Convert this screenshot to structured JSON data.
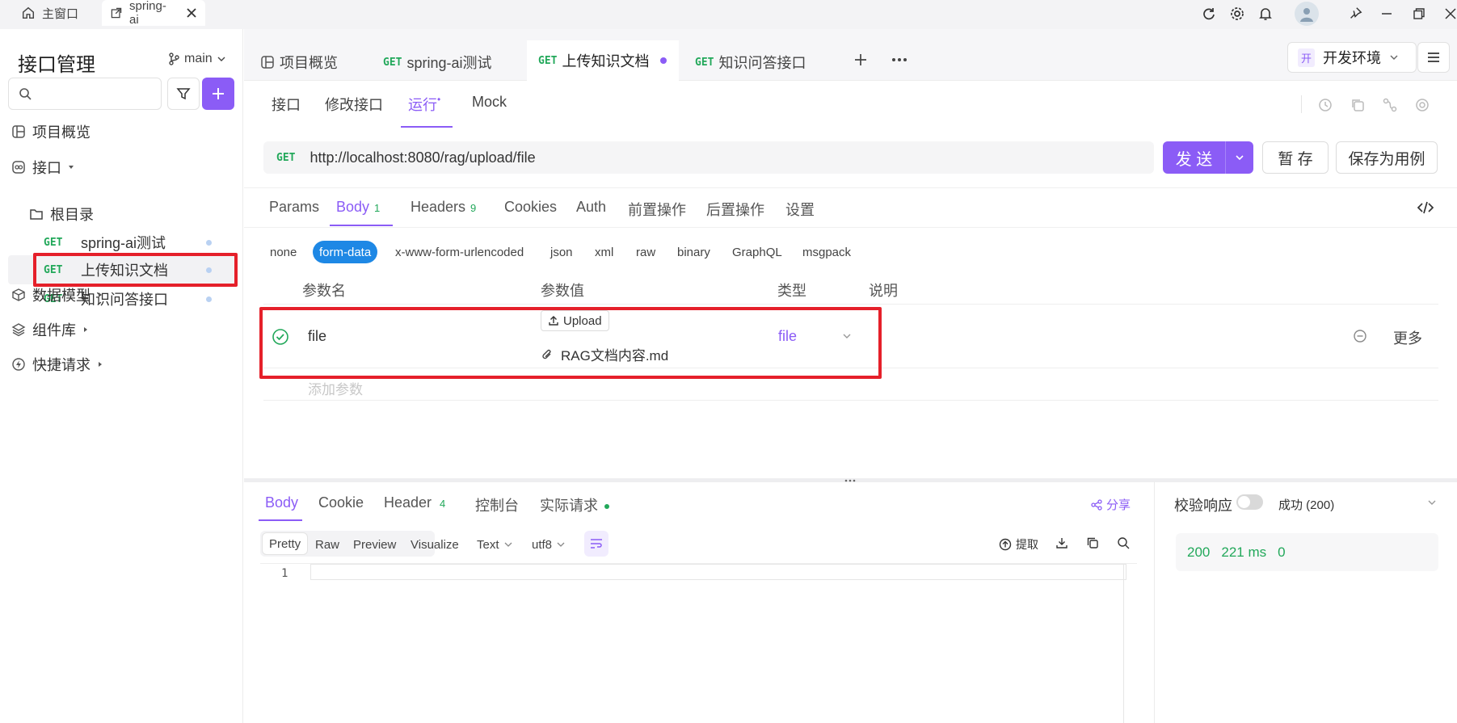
{
  "titlebar": {
    "home_tab": "主窗口",
    "project_tab": "spring-ai"
  },
  "sidebar": {
    "title": "接口管理",
    "branch": "main",
    "nav": {
      "overview": "项目概览",
      "api": "接口",
      "root": "根目录",
      "models": "数据模型",
      "components": "组件库",
      "quick": "快捷请求"
    },
    "endpoints": [
      {
        "method": "GET",
        "name": "spring-ai测试"
      },
      {
        "method": "GET",
        "name": "上传知识文档"
      },
      {
        "method": "GET",
        "name": "知识问答接口"
      }
    ]
  },
  "tabs": {
    "overview": "项目概览",
    "items": [
      {
        "method": "GET",
        "name": "spring-ai测试"
      },
      {
        "method": "GET",
        "name": "上传知识文档"
      },
      {
        "method": "GET",
        "name": "知识问答接口"
      }
    ]
  },
  "env": {
    "badge": "开",
    "label": "开发环境"
  },
  "subtabs": {
    "api": "接口",
    "edit": "修改接口",
    "run": "运行",
    "mock": "Mock"
  },
  "request": {
    "method": "GET",
    "url": "http://localhost:8080/rag/upload/file",
    "send": "发 送",
    "save_temp": "暂 存",
    "save_case": "保存为用例"
  },
  "section_tabs": {
    "params": "Params",
    "body": "Body",
    "body_count": "1",
    "headers": "Headers",
    "headers_count": "9",
    "cookies": "Cookies",
    "auth": "Auth",
    "pre": "前置操作",
    "post": "后置操作",
    "settings": "设置"
  },
  "body_types": [
    "none",
    "form-data",
    "x-www-form-urlencoded",
    "json",
    "xml",
    "raw",
    "binary",
    "GraphQL",
    "msgpack"
  ],
  "params_table": {
    "headers": {
      "name": "参数名",
      "value": "参数值",
      "type": "类型",
      "desc": "说明"
    },
    "row": {
      "name": "file",
      "upload_label": "Upload",
      "file_name": "RAG文档内容.md",
      "type": "file",
      "more": "更多"
    },
    "add_placeholder": "添加参数"
  },
  "response": {
    "tabs": {
      "body": "Body",
      "cookie": "Cookie",
      "header": "Header",
      "header_count": "4",
      "console": "控制台",
      "actual": "实际请求"
    },
    "share": "分享",
    "formats": [
      "Pretty",
      "Raw",
      "Preview",
      "Visualize"
    ],
    "text_select": "Text",
    "encoding": "utf8",
    "extract": "提取",
    "line_number": "1"
  },
  "validation": {
    "label": "校验响应",
    "status_select": "成功 (200)",
    "status_code": "200",
    "time": "221 ms",
    "size": "0"
  },
  "colors": {
    "accent": "#8b5cf6",
    "get": "#22a85a",
    "highlight": "#e5202a",
    "chip_active": "#1e88e5"
  }
}
